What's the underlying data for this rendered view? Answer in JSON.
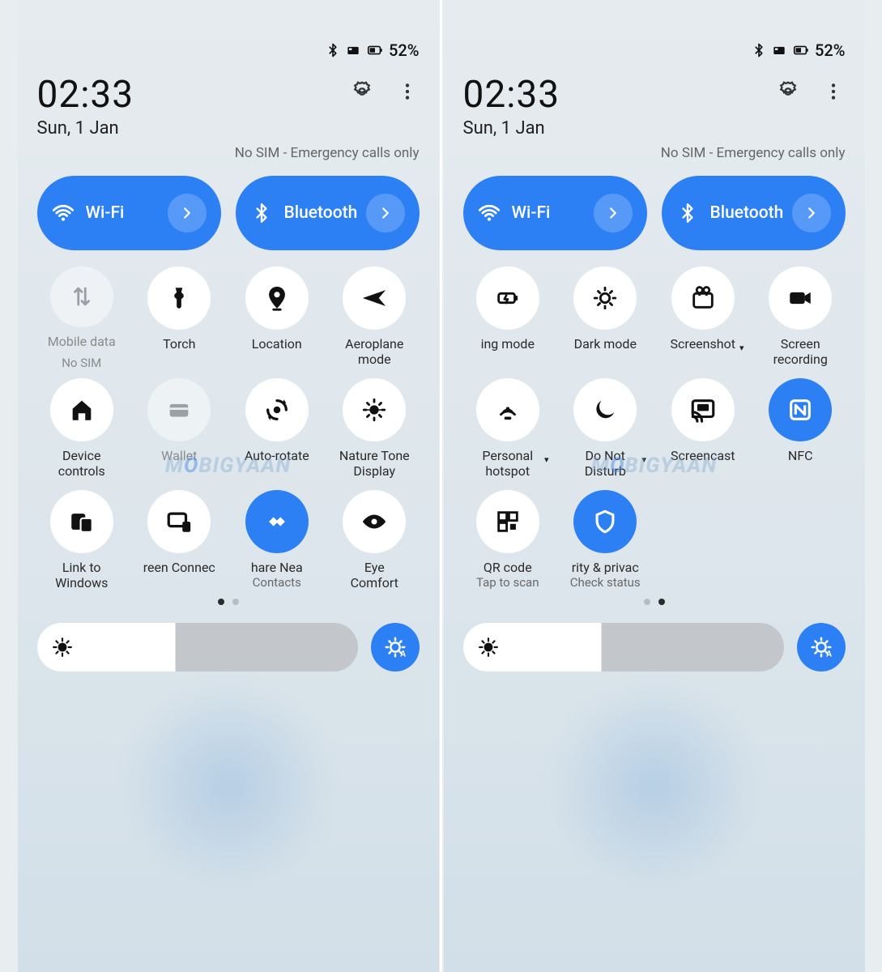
{
  "watermark_prefix": "M",
  "watermark_o": "O",
  "watermark_suffix": "BIGYAAN",
  "status": {
    "battery": "52%"
  },
  "header": {
    "time": "02:33",
    "date": "Sun, 1 Jan",
    "sim": "No SIM - Emergency calls only"
  },
  "toggles": {
    "wifi": "Wi-Fi",
    "bluetooth": "Bluetooth"
  },
  "page1": [
    {
      "id": "mobile-data",
      "label": "Mobile data",
      "sub": "No SIM",
      "state": "off",
      "muted": true,
      "icon": "data"
    },
    {
      "id": "torch",
      "label": "Torch",
      "icon": "torch"
    },
    {
      "id": "location",
      "label": "Location",
      "icon": "location"
    },
    {
      "id": "aeroplane",
      "label": "Aeroplane\nmode",
      "icon": "plane"
    },
    {
      "id": "device-controls",
      "label": "Device\ncontrols",
      "icon": "home"
    },
    {
      "id": "wallet",
      "label": "Wallet",
      "state": "off",
      "muted": true,
      "icon": "wallet"
    },
    {
      "id": "auto-rotate",
      "label": "Auto-rotate",
      "icon": "rotate"
    },
    {
      "id": "nature-tone",
      "label": "Nature Tone\nDisplay",
      "icon": "naturetone"
    },
    {
      "id": "link-windows",
      "label": "Link to\nWindows",
      "icon": "linkwin"
    },
    {
      "id": "screen-connect",
      "label": "reen Connec",
      "icon": "screenconnect"
    },
    {
      "id": "nearby-share",
      "label": "hare     Nea",
      "sub": "Contacts",
      "state": "on",
      "icon": "nearby"
    },
    {
      "id": "eye-comfort",
      "label": "Eye\nComfort",
      "icon": "eye"
    }
  ],
  "page2": [
    {
      "id": "saving-mode",
      "label": "ing mode",
      "icon": "saving"
    },
    {
      "id": "dark-mode",
      "label": "Dark mode",
      "icon": "dark"
    },
    {
      "id": "screenshot",
      "label": "Screenshot",
      "caret": true,
      "icon": "screenshot"
    },
    {
      "id": "screen-recording",
      "label": "Screen\nrecording",
      "icon": "recording"
    },
    {
      "id": "hotspot",
      "label": "Personal\nhotspot",
      "caret": true,
      "icon": "hotspot"
    },
    {
      "id": "dnd",
      "label": "Do Not\nDisturb",
      "caret": true,
      "icon": "dnd"
    },
    {
      "id": "screencast",
      "label": "Screencast",
      "icon": "cast"
    },
    {
      "id": "nfc",
      "label": "NFC",
      "state": "on",
      "icon": "nfc"
    },
    {
      "id": "qr",
      "label": "QR code",
      "sub": "Tap to scan",
      "icon": "qr"
    },
    {
      "id": "security",
      "label": "rity & privac",
      "sub": "Check status",
      "state": "on",
      "icon": "shield"
    }
  ]
}
